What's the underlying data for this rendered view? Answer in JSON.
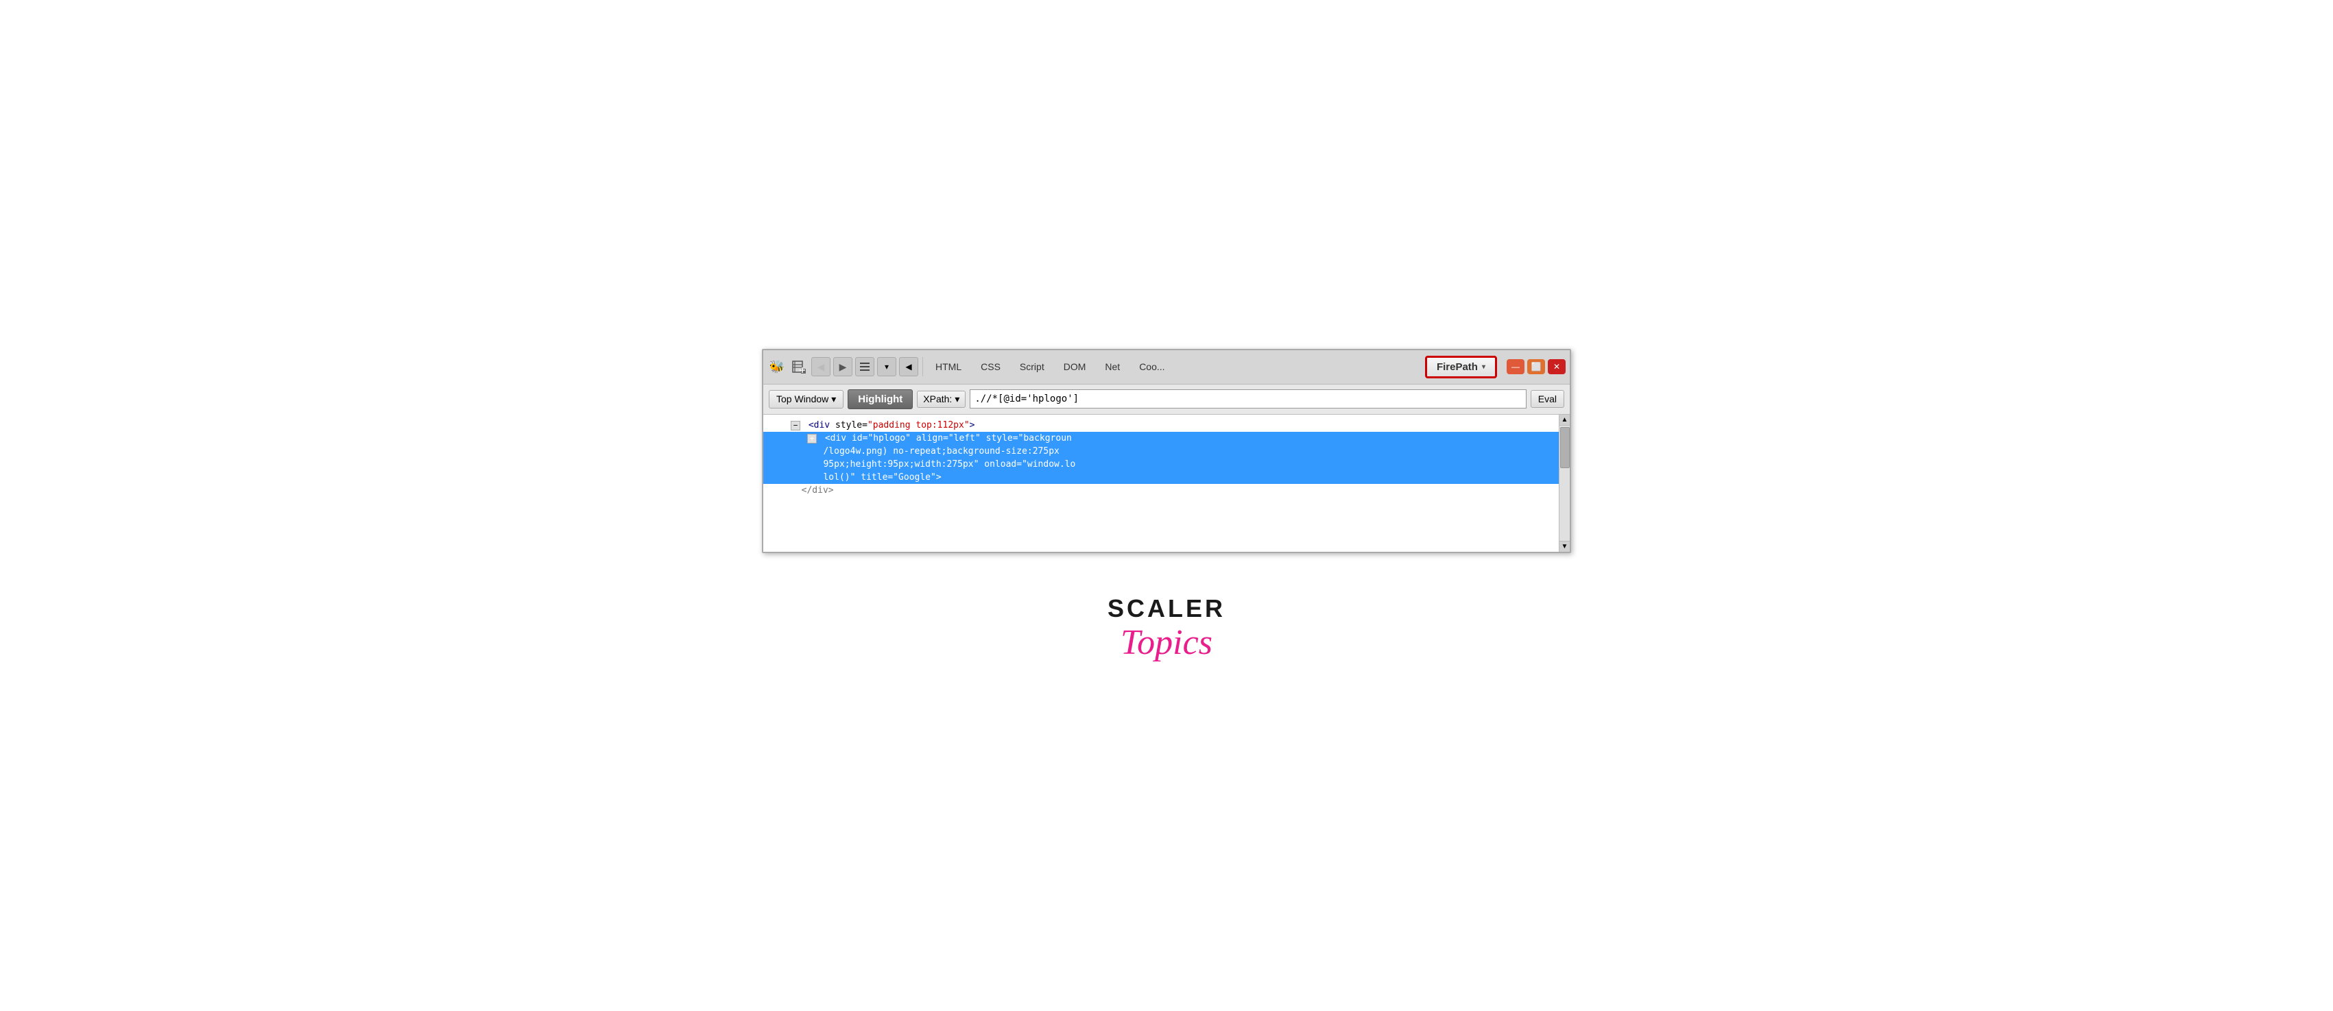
{
  "devtools": {
    "toolbar": {
      "tabs": [
        "HTML",
        "CSS",
        "Script",
        "DOM",
        "Net",
        "Coo..."
      ],
      "firepath_label": "FirePath",
      "firepath_dropdown": "▾"
    },
    "addressbar": {
      "top_window_label": "Top Window",
      "top_window_arrow": "▾",
      "highlight_label": "Highlight",
      "xpath_label": "XPath:",
      "xpath_arrow": "▾",
      "xpath_value": ".//*[@id='hplogo']",
      "eval_label": "Eval"
    },
    "content": {
      "line1": "<div style=\"padding top:112px\">",
      "line2_prefix": "<div id=\"hplogo\" align=\"left\" style=\"backgroun",
      "line2_cont1": "/logo4w.png) no-repeat;background-size:275px",
      "line2_cont2": "95px;height:95px;width:275px\" onload=\"window.lo",
      "line2_cont3": "lol()\" title=\"Google\">"
    }
  },
  "logo": {
    "scaler": "SCALER",
    "topics": "Topics"
  },
  "icons": {
    "bee": "🐝",
    "inspector": "🔍",
    "back": "◀",
    "forward": "▶",
    "menu": "≡",
    "dropdown": "▾",
    "collapse": "−",
    "expand": "+"
  },
  "window_controls": {
    "minimize": "—",
    "maximize": "⬜",
    "close": "✕"
  }
}
